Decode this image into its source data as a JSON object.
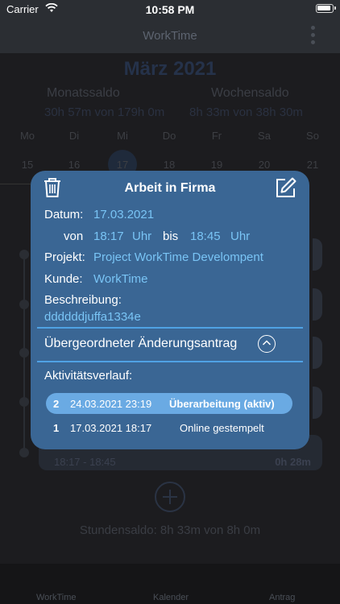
{
  "status": {
    "carrier": "Carrier",
    "time": "10:58 PM"
  },
  "nav": {
    "title": "WorkTime"
  },
  "calendar": {
    "month": "März 2021",
    "monatssaldo_label": "Monatssaldo",
    "monatssaldo_value": "30h 57m von 179h 0m",
    "wochensaldo_label": "Wochensaldo",
    "wochensaldo_value": "8h 33m von 38h 30m",
    "weekdays": [
      "Mo",
      "Di",
      "Mi",
      "Do",
      "Fr",
      "Sa",
      "So"
    ],
    "days": [
      "15",
      "16",
      "17",
      "18",
      "19",
      "20",
      "21"
    ]
  },
  "background_entry": {
    "time": "18:17 - 18:45",
    "duration": "0h 28m"
  },
  "stundensaldo": "Stundensaldo: 8h 33m von 8h 0m",
  "tabs": {
    "worktime": "WorkTime",
    "kalender": "Kalender",
    "antrag": "Antrag"
  },
  "popup": {
    "title": "Arbeit in Firma",
    "datum_label": "Datum:",
    "datum_value": "17.03.2021",
    "von_label": "von",
    "von_value": "18:17",
    "uhr1": "Uhr",
    "bis_label": "bis",
    "bis_value": "18:45",
    "uhr2": "Uhr",
    "projekt_label": "Projekt:",
    "projekt_value": "Project WorkTime Develompent",
    "kunde_label": "Kunde:",
    "kunde_value": "WorkTime",
    "beschreibung_label": "Beschreibung:",
    "beschreibung_value": "ddddddjuffa1334e",
    "parent_label": "Übergeordneter Änderungsantrag",
    "verlauf_label": "Aktivitätsverlauf:",
    "history": [
      {
        "num": "2",
        "date": "24.03.2021 23:19",
        "status": "Überarbeitung (aktiv)"
      },
      {
        "num": "1",
        "date": "17.03.2021 18:17",
        "status": "Online gestempelt"
      }
    ]
  }
}
